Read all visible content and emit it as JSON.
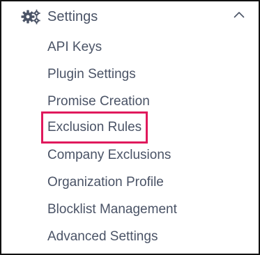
{
  "section": {
    "title": "Settings",
    "icon": "gears-icon",
    "expanded_icon": "chevron-up-icon"
  },
  "menu": {
    "items": [
      {
        "label": "API Keys"
      },
      {
        "label": "Plugin Settings"
      },
      {
        "label": "Promise Creation"
      },
      {
        "label": "Exclusion Rules",
        "highlighted": true
      },
      {
        "label": "Company Exclusions"
      },
      {
        "label": "Organization Profile"
      },
      {
        "label": "Blocklist Management"
      },
      {
        "label": "Advanced Settings"
      }
    ]
  },
  "colors": {
    "text": "#4a5366",
    "highlight_border": "#e0195c",
    "frame_border": "#111111"
  }
}
